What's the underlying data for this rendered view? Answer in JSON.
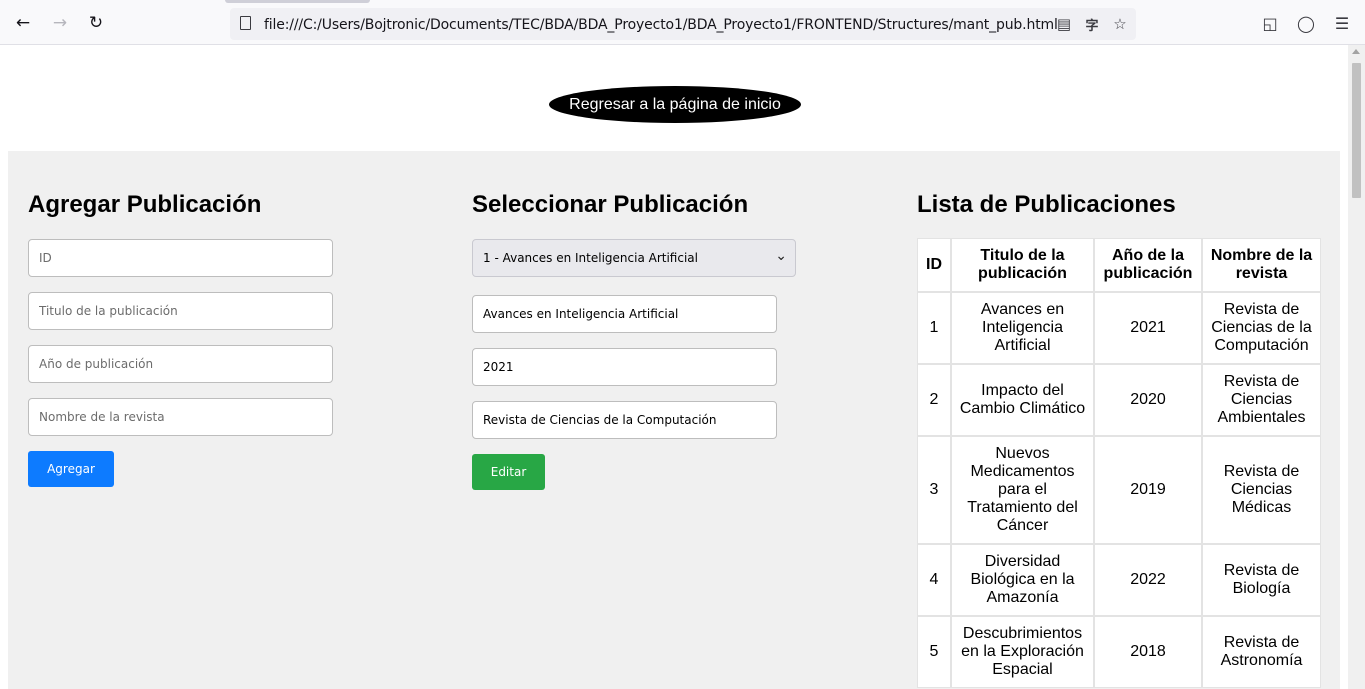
{
  "browser": {
    "url": "file:///C:/Users/Bojtronic/Documents/TEC/BDA/BDA_Proyecto1/BDA_Proyecto1/FRONTEND/Structures/mant_pub.html",
    "back_icon": "arrow-left-icon",
    "forward_icon": "arrow-right-icon",
    "reload_icon": "reload-icon"
  },
  "home_button": {
    "label": "Regresar a la página de inicio"
  },
  "add_form": {
    "title": "Agregar Publicación",
    "id_placeholder": "ID",
    "titulo_placeholder": "Titulo de la publicación",
    "anio_placeholder": "Año de publicación",
    "revista_placeholder": "Nombre de la revista",
    "submit_label": "Agregar"
  },
  "select_form": {
    "title": "Seleccionar Publicación",
    "selected_option": "1 - Avances en Inteligencia Artificial",
    "titulo_value": "Avances en Inteligencia Artificial",
    "anio_value": "2021",
    "revista_value": "Revista de Ciencias de la Computación",
    "edit_label": "Editar"
  },
  "list": {
    "title": "Lista de Publicaciones",
    "headers": [
      "ID",
      "Titulo de la publicación",
      "Año de la publicación",
      "Nombre de la revista"
    ],
    "rows": [
      [
        "1",
        "Avances en Inteligencia Artificial",
        "2021",
        "Revista de Ciencias de la Computación"
      ],
      [
        "2",
        "Impacto del Cambio Climático",
        "2020",
        "Revista de Ciencias Ambientales"
      ],
      [
        "3",
        "Nuevos Medicamentos para el Tratamiento del Cáncer",
        "2019",
        "Revista de Ciencias Médicas"
      ],
      [
        "4",
        "Diversidad Biológica en la Amazonía",
        "2022",
        "Revista de Biología"
      ],
      [
        "5",
        "Descubrimientos en la Exploración Espacial",
        "2018",
        "Revista de Astronomía"
      ]
    ]
  },
  "colors": {
    "add_button": "#0d7bff",
    "edit_button": "#28a745",
    "panel_background": "#f0f0f0",
    "home_button": "#000000"
  }
}
